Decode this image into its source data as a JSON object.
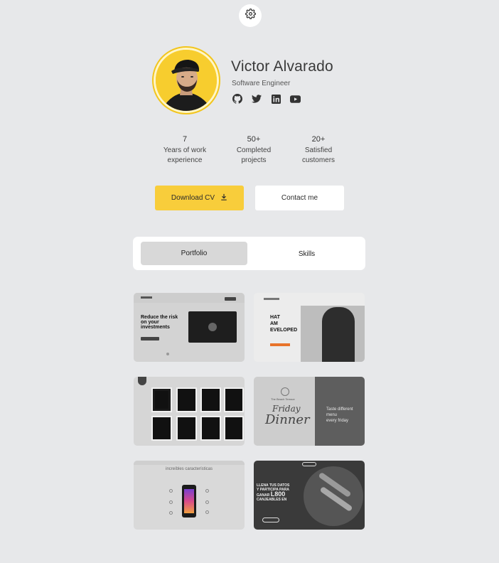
{
  "profile": {
    "name": "Victor Alvarado",
    "role": "Software Engineer",
    "socials": [
      "github-icon",
      "twitter-icon",
      "linkedin-icon",
      "youtube-icon"
    ]
  },
  "stats": [
    {
      "value": "7",
      "label_line1": "Years of work",
      "label_line2": "experience"
    },
    {
      "value": "50+",
      "label_line1": "Completed",
      "label_line2": "projects"
    },
    {
      "value": "20+",
      "label_line1": "Satisfied",
      "label_line2": "customers"
    }
  ],
  "actions": {
    "download_cv": "Download CV",
    "contact": "Contact me"
  },
  "tabs": {
    "active": "Portfolio",
    "other": "Skills"
  },
  "portfolio": {
    "card1": {
      "headline_1": "Reduce the risk",
      "headline_2": "on your",
      "headline_3": "investments"
    },
    "card2": {
      "line_1": "HAT",
      "line_2": "AM",
      "line_3": "EVELOPED"
    },
    "card4": {
      "brand": "The Beach Terrace",
      "script_1": "Friday",
      "script_2": "Dinner",
      "side_1": "Taste different",
      "side_2": "menu",
      "side_3": "every friday"
    },
    "card5": {
      "title": "increíbles características"
    },
    "card6": {
      "line_1": "LLENA TUS DATOS",
      "line_2": "Y PARTICIPA PARA",
      "line_3": "GANAR",
      "line_4": "L800",
      "line_5": "CANJEABLES EN"
    }
  },
  "colors": {
    "background": "#e7e8ea",
    "accent": "#f8cd3b",
    "card": "#ffffff"
  }
}
